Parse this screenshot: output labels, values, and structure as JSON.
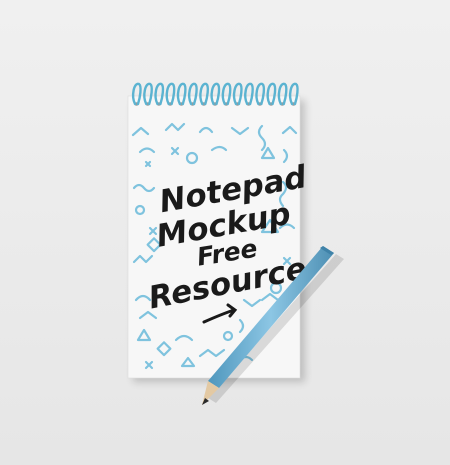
{
  "scene": {
    "background": "#ececec",
    "notepad": {
      "paper_color": "#f7f7f7",
      "pattern_color": "#7fc3de",
      "spiral_color": "#5bb3d1",
      "spiral_rings": 15
    },
    "lettering": {
      "lines": [
        "Notepad",
        "Mockup",
        "Free",
        "Resource"
      ],
      "ink_color": "#1a1a1a"
    },
    "pencil": {
      "body_color": "#74b4d6",
      "wood_color": "#e3c9a3",
      "lead_color": "#2b2b2b"
    }
  }
}
